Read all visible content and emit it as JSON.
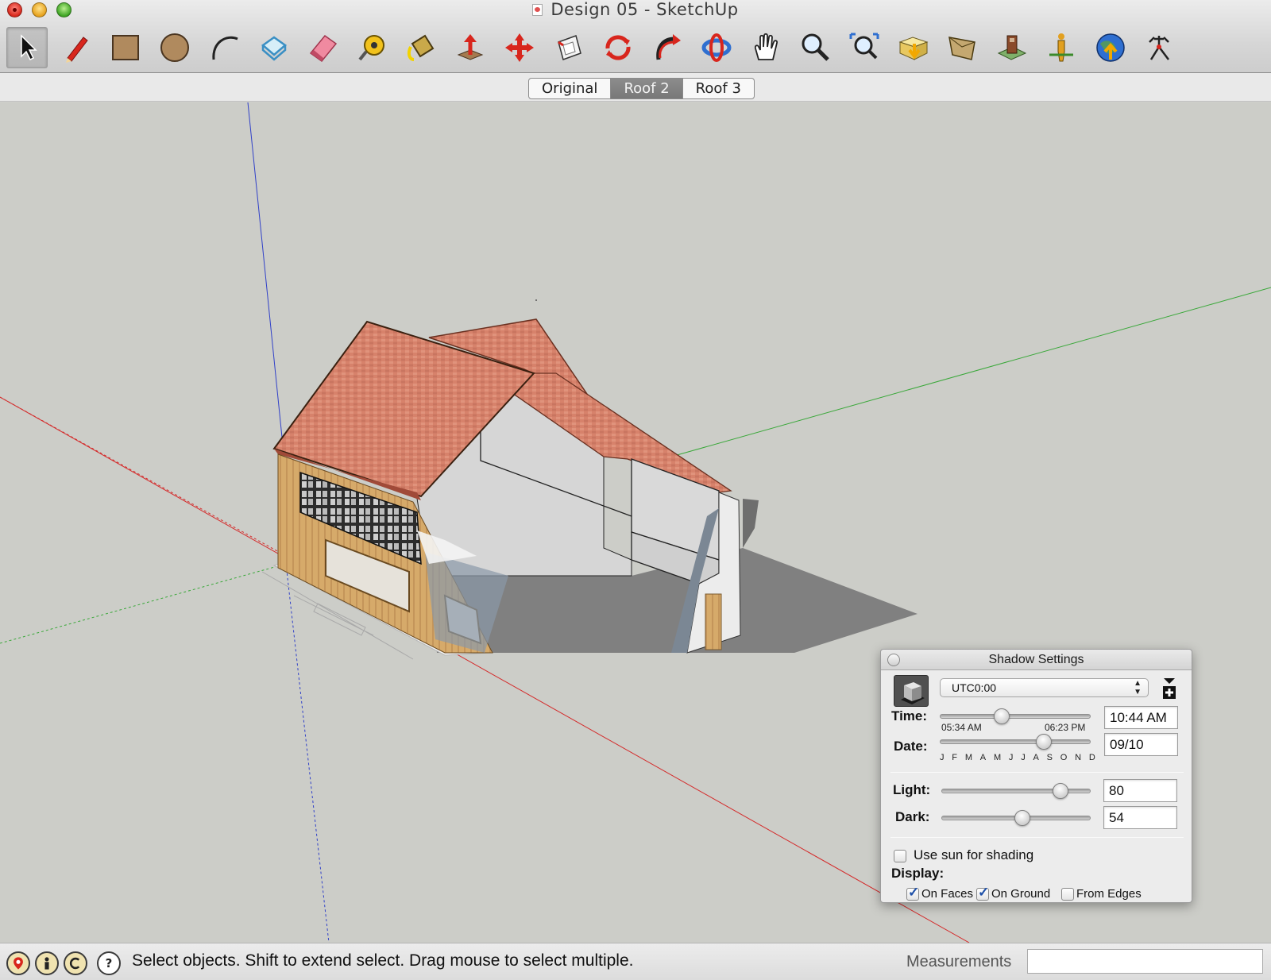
{
  "window": {
    "title": "Design 05 - SketchUp"
  },
  "toolbar": {
    "tools": [
      {
        "id": "select",
        "icon": "select-arrow-icon"
      },
      {
        "id": "line",
        "icon": "pencil-icon"
      },
      {
        "id": "rectangle",
        "icon": "rectangle-icon"
      },
      {
        "id": "circle",
        "icon": "circle-icon"
      },
      {
        "id": "arc",
        "icon": "arc-icon"
      },
      {
        "id": "make-component",
        "icon": "component-icon"
      },
      {
        "id": "eraser",
        "icon": "eraser-icon"
      },
      {
        "id": "tape-measure",
        "icon": "tape-measure-icon"
      },
      {
        "id": "paint-bucket",
        "icon": "paint-bucket-icon"
      },
      {
        "id": "push-pull",
        "icon": "push-pull-icon"
      },
      {
        "id": "move",
        "icon": "move-icon"
      },
      {
        "id": "offset",
        "icon": "offset-icon"
      },
      {
        "id": "rotate",
        "icon": "rotate-icon"
      },
      {
        "id": "follow-me",
        "icon": "follow-me-icon"
      },
      {
        "id": "orbit",
        "icon": "orbit-icon"
      },
      {
        "id": "pan",
        "icon": "hand-pan-icon"
      },
      {
        "id": "zoom",
        "icon": "zoom-icon"
      },
      {
        "id": "zoom-extents",
        "icon": "zoom-extents-icon"
      },
      {
        "id": "get-models",
        "icon": "get-models-icon"
      },
      {
        "id": "share-model",
        "icon": "share-model-icon"
      },
      {
        "id": "get-photo-texture",
        "icon": "photo-texture-icon"
      },
      {
        "id": "walk",
        "icon": "walk-icon"
      },
      {
        "id": "google-earth",
        "icon": "earth-icon"
      },
      {
        "id": "add-location",
        "icon": "location-icon"
      }
    ],
    "active_tool": "select"
  },
  "scene_tabs": {
    "tabs": [
      "Original",
      "Roof 2",
      "Roof 3"
    ],
    "selected": "Roof 2"
  },
  "shadow_settings": {
    "title": "Shadow Settings",
    "timezone": "UTC0:00",
    "time_label": "Time:",
    "time_value": "10:44 AM",
    "time_start": "05:34 AM",
    "time_end": "06:23 PM",
    "time_fraction": 0.41,
    "date_label": "Date:",
    "date_value": "09/10",
    "months": [
      "J",
      "F",
      "M",
      "A",
      "M",
      "J",
      "J",
      "A",
      "S",
      "O",
      "N",
      "D"
    ],
    "date_fraction": 0.69,
    "light_label": "Light:",
    "light_value": "80",
    "dark_label": "Dark:",
    "dark_value": "54",
    "use_sun_label": "Use sun for shading",
    "use_sun_checked": false,
    "display_label": "Display:",
    "on_faces_label": "On Faces",
    "on_faces_checked": true,
    "on_ground_label": "On Ground",
    "on_ground_checked": true,
    "from_edges_label": "From Edges",
    "from_edges_checked": false
  },
  "statusbar": {
    "message": "Select objects. Shift to extend select. Drag mouse to select multiple.",
    "measurements_label": "Measurements",
    "measurements_value": "",
    "help_icon": "?"
  },
  "colors": {
    "axis_red": "#d42a2a",
    "axis_green": "#3aa83a",
    "axis_blue": "#3040c8",
    "roof": "#d9806a",
    "wall": "#d8d8d8",
    "shadow": "#808080",
    "sky": "#cccdc8"
  }
}
